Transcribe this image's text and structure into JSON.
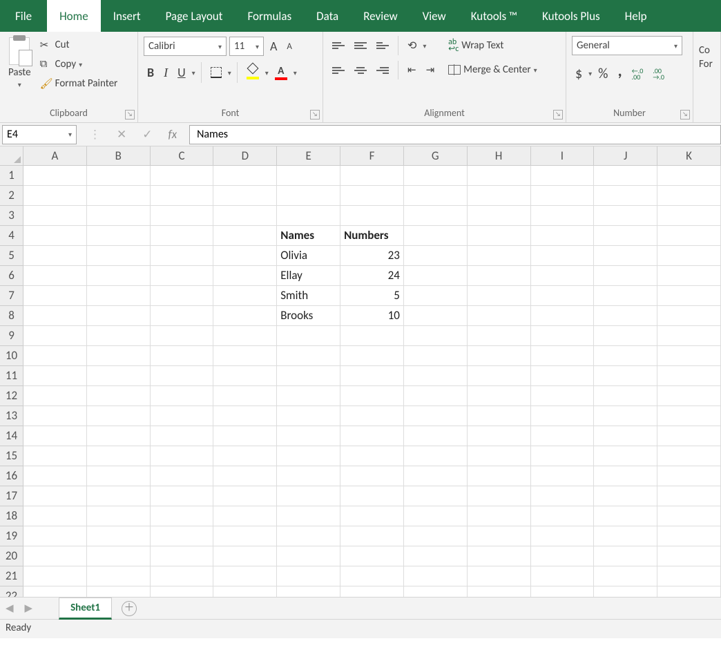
{
  "tabs": {
    "file": "File",
    "home": "Home",
    "insert": "Insert",
    "pagelayout": "Page Layout",
    "formulas": "Formulas",
    "data": "Data",
    "review": "Review",
    "view": "View",
    "kutools": "Kutools ™",
    "kutoolsplus": "Kutools Plus",
    "help": "Help"
  },
  "clipboard": {
    "paste": "Paste",
    "cut": "Cut",
    "copy": "Copy",
    "formatpainter": "Format Painter",
    "group": "Clipboard"
  },
  "font": {
    "name": "Calibri",
    "size": "11",
    "group": "Font"
  },
  "alignment": {
    "wrap": "Wrap Text",
    "merge": "Merge & Center",
    "group": "Alignment"
  },
  "number": {
    "format": "General",
    "group": "Number"
  },
  "cond": {
    "label1": "Co",
    "label2": "For"
  },
  "fbar": {
    "namebox": "E4",
    "formula": "Names"
  },
  "grid": {
    "cols": [
      "A",
      "B",
      "C",
      "D",
      "E",
      "F",
      "G",
      "H",
      "I",
      "J",
      "K"
    ],
    "rows": 22,
    "data": {
      "4": {
        "E": {
          "v": "Names",
          "bold": true
        },
        "F": {
          "v": "Numbers",
          "bold": true
        }
      },
      "5": {
        "E": {
          "v": "Olivia"
        },
        "F": {
          "v": "23",
          "num": true
        }
      },
      "6": {
        "E": {
          "v": "Ellay"
        },
        "F": {
          "v": "24",
          "num": true
        }
      },
      "7": {
        "E": {
          "v": "Smith"
        },
        "F": {
          "v": "5",
          "num": true
        }
      },
      "8": {
        "E": {
          "v": "Brooks"
        },
        "F": {
          "v": "10",
          "num": true
        }
      }
    }
  },
  "sheets": {
    "sheet1": "Sheet1"
  },
  "status": {
    "ready": "Ready"
  }
}
